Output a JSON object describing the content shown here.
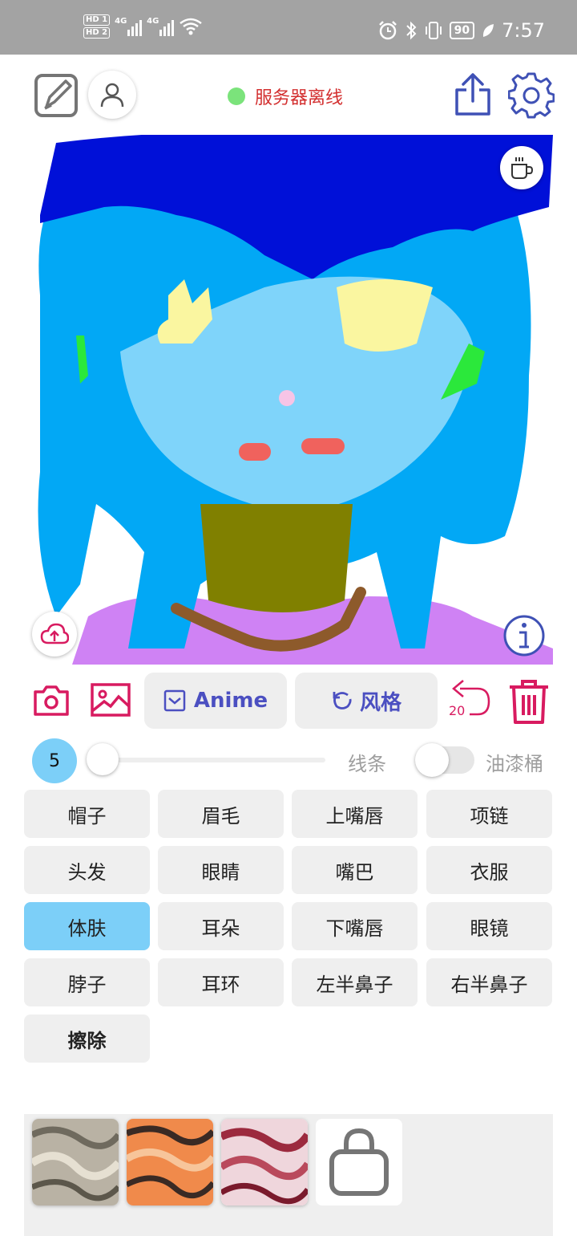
{
  "status_bar": {
    "hd1": "HD 1",
    "hd2": "HD 2",
    "network1": "4G",
    "network2": "4G",
    "battery": "90",
    "time": "7:57",
    "icons": [
      "alarm-icon",
      "bluetooth-icon",
      "vibrate-icon",
      "leaf-icon",
      "wifi-icon"
    ]
  },
  "header": {
    "server_status": "服务器离线",
    "server_status_color": "#d32f2f",
    "online_dot_color": "#7be37b",
    "icons": [
      "edit-icon",
      "user-icon",
      "share-icon",
      "gear-icon"
    ]
  },
  "canvas": {
    "icons": [
      "coffee-cup-icon",
      "cloud-upload-icon",
      "info-icon"
    ]
  },
  "toolbar": {
    "anime_label": "Anime",
    "style_label": "风格",
    "undo_count": "20",
    "accent_color": "#4b4fc1",
    "action_color": "#d81b60",
    "icons": [
      "camera-icon",
      "image-icon",
      "checkbox-icon",
      "rotate-icon",
      "undo-icon",
      "trash-icon"
    ]
  },
  "brush": {
    "size": "5",
    "line_label": "线条",
    "bucket_label": "油漆桶",
    "bucket_enabled": false
  },
  "parts": [
    {
      "label": "帽子"
    },
    {
      "label": "眉毛"
    },
    {
      "label": "上嘴唇"
    },
    {
      "label": "项链"
    },
    {
      "label": "头发"
    },
    {
      "label": "眼睛"
    },
    {
      "label": "嘴巴"
    },
    {
      "label": "衣服"
    },
    {
      "label": "体肤",
      "active": true
    },
    {
      "label": "耳朵"
    },
    {
      "label": "下嘴唇"
    },
    {
      "label": "眼镜"
    },
    {
      "label": "脖子"
    },
    {
      "label": "耳环"
    },
    {
      "label": "左半鼻子"
    },
    {
      "label": "右半鼻子"
    },
    {
      "label": "擦除"
    }
  ],
  "textures": {
    "items": [
      "texture-silver",
      "texture-orange",
      "texture-crimson"
    ],
    "shop_icon": "shopping-bag-icon"
  },
  "colors": {
    "selected_part": "#7ccff8",
    "part_background": "#efefef"
  }
}
